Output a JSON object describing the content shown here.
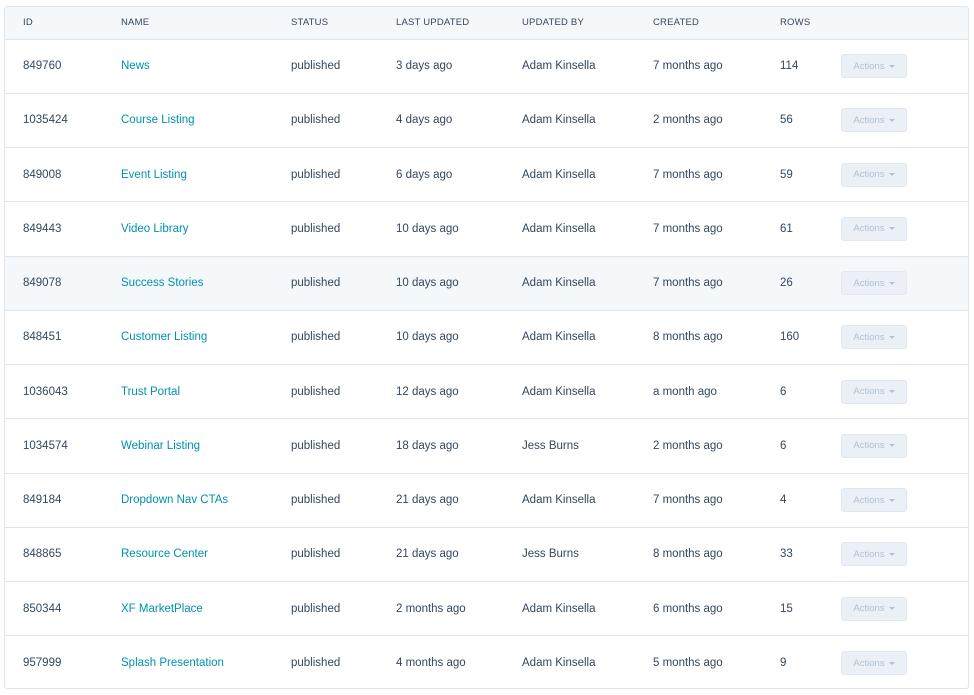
{
  "table": {
    "columns": {
      "id": "ID",
      "name": "NAME",
      "status": "STATUS",
      "last_updated": "LAST UPDATED",
      "updated_by": "UPDATED BY",
      "created": "CREATED",
      "rows": "ROWS"
    },
    "actions_label": "Actions",
    "rows": [
      {
        "id": "849760",
        "name": "News",
        "status": "published",
        "last_updated": "3 days ago",
        "updated_by": "Adam Kinsella",
        "created": "7 months ago",
        "rows": "114"
      },
      {
        "id": "1035424",
        "name": "Course Listing",
        "status": "published",
        "last_updated": "4 days ago",
        "updated_by": "Adam Kinsella",
        "created": "2 months ago",
        "rows": "56"
      },
      {
        "id": "849008",
        "name": "Event Listing",
        "status": "published",
        "last_updated": "6 days ago",
        "updated_by": "Adam Kinsella",
        "created": "7 months ago",
        "rows": "59"
      },
      {
        "id": "849443",
        "name": "Video Library",
        "status": "published",
        "last_updated": "10 days ago",
        "updated_by": "Adam Kinsella",
        "created": "7 months ago",
        "rows": "61"
      },
      {
        "id": "849078",
        "name": "Success Stories",
        "status": "published",
        "last_updated": "10 days ago",
        "updated_by": "Adam Kinsella",
        "created": "7 months ago",
        "rows": "26"
      },
      {
        "id": "848451",
        "name": "Customer Listing",
        "status": "published",
        "last_updated": "10 days ago",
        "updated_by": "Adam Kinsella",
        "created": "8 months ago",
        "rows": "160"
      },
      {
        "id": "1036043",
        "name": "Trust Portal",
        "status": "published",
        "last_updated": "12 days ago",
        "updated_by": "Adam Kinsella",
        "created": "a month ago",
        "rows": "6"
      },
      {
        "id": "1034574",
        "name": "Webinar Listing",
        "status": "published",
        "last_updated": "18 days ago",
        "updated_by": "Jess Burns",
        "created": "2 months ago",
        "rows": "6"
      },
      {
        "id": "849184",
        "name": "Dropdown Nav CTAs",
        "status": "published",
        "last_updated": "21 days ago",
        "updated_by": "Adam Kinsella",
        "created": "7 months ago",
        "rows": "4"
      },
      {
        "id": "848865",
        "name": "Resource Center",
        "status": "published",
        "last_updated": "21 days ago",
        "updated_by": "Jess Burns",
        "created": "8 months ago",
        "rows": "33"
      },
      {
        "id": "850344",
        "name": "XF MarketPlace",
        "status": "published",
        "last_updated": "2 months ago",
        "updated_by": "Adam Kinsella",
        "created": "6 months ago",
        "rows": "15"
      },
      {
        "id": "957999",
        "name": "Splash Presentation",
        "status": "published",
        "last_updated": "4 months ago",
        "updated_by": "Adam Kinsella",
        "created": "5 months ago",
        "rows": "9"
      }
    ]
  },
  "colors": {
    "link": "#0091ae",
    "text": "#33475b",
    "header_bg": "#f5f8fa",
    "border": "#dfe3eb",
    "button_bg": "#eaf0f6",
    "button_text": "#b0c1d4"
  }
}
